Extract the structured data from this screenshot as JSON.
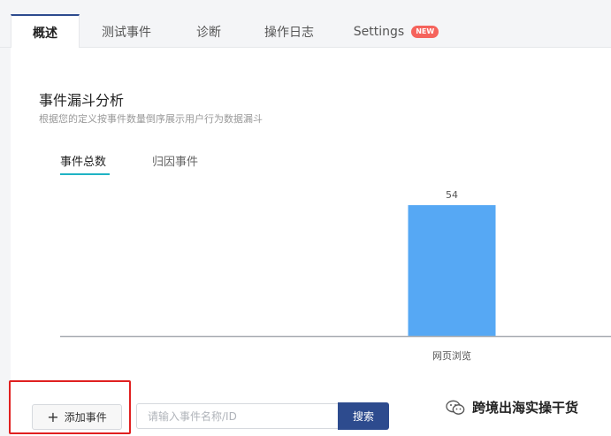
{
  "tabs": [
    {
      "label": "概述",
      "active": true
    },
    {
      "label": "测试事件",
      "active": false
    },
    {
      "label": "诊断",
      "active": false
    },
    {
      "label": "操作日志",
      "active": false
    },
    {
      "label": "Settings",
      "active": false,
      "badge": "NEW"
    }
  ],
  "section": {
    "title": "事件漏斗分析",
    "subtitle": "根据您的定义按事件数量倒序展示用户行为数据漏斗"
  },
  "subtabs": [
    {
      "label": "事件总数",
      "active": true
    },
    {
      "label": "归因事件",
      "active": false
    }
  ],
  "chart_data": {
    "type": "bar",
    "categories": [
      "网页浏览"
    ],
    "values": [
      54
    ],
    "data_labels": [
      "54"
    ],
    "bar_color": "#56a8f4",
    "grid": false
  },
  "actions": {
    "add_event_label": "添加事件",
    "search_placeholder": "请输入事件名称/ID",
    "search_button": "搜索"
  },
  "watermark": {
    "text": "跨境出海实操干货",
    "icon": "wechat-icon"
  },
  "colors": {
    "accent": "#2d4b8e",
    "badge": "#f5635c",
    "subtab_underline": "#1fb3c4",
    "highlight": "#e02020"
  }
}
